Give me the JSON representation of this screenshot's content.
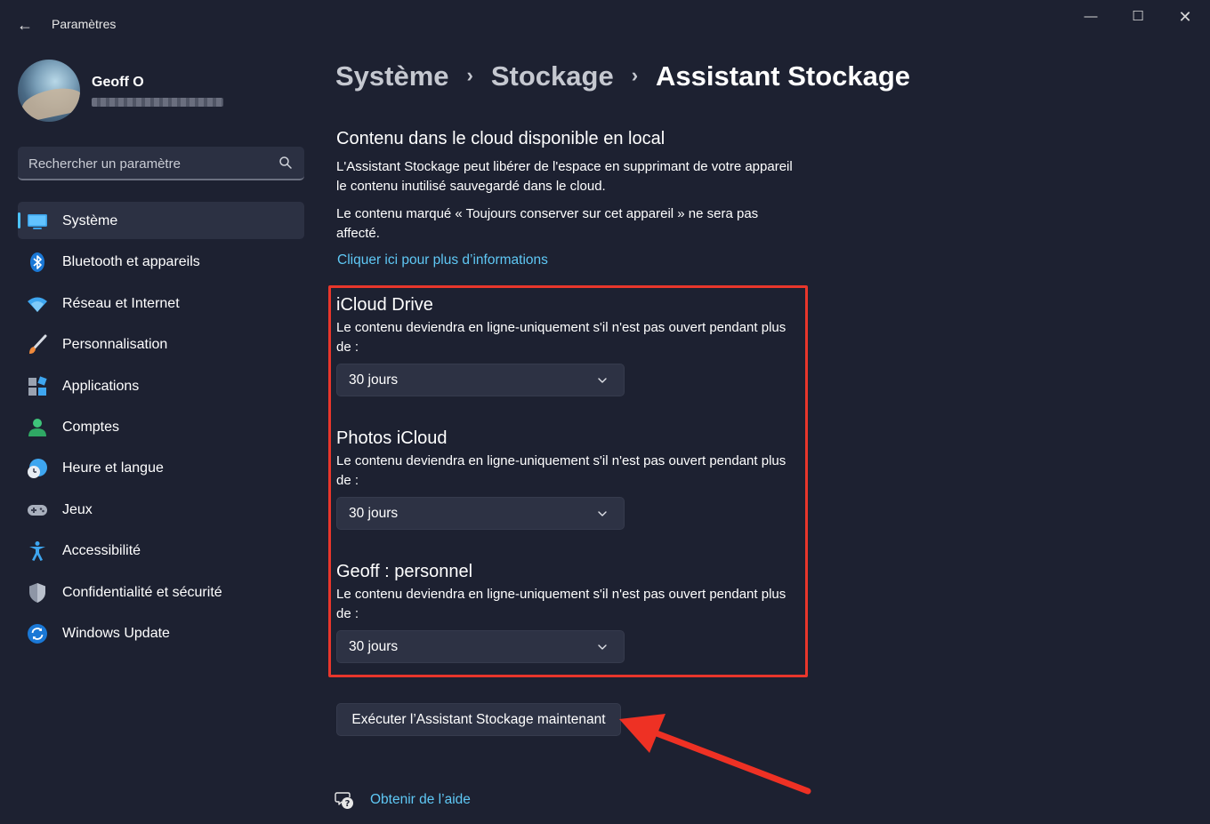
{
  "window": {
    "title": "Paramètres",
    "controls": {
      "minimize": "—",
      "maximize": "☐",
      "close": "✕"
    }
  },
  "user": {
    "name": "Geoff O"
  },
  "search": {
    "placeholder": "Rechercher un paramètre"
  },
  "nav": {
    "items": [
      {
        "label": "Système",
        "icon": "system-icon",
        "active": true
      },
      {
        "label": "Bluetooth et appareils",
        "icon": "bluetooth-icon"
      },
      {
        "label": "Réseau et Internet",
        "icon": "wifi-icon"
      },
      {
        "label": "Personnalisation",
        "icon": "brush-icon"
      },
      {
        "label": "Applications",
        "icon": "apps-icon"
      },
      {
        "label": "Comptes",
        "icon": "account-icon"
      },
      {
        "label": "Heure et langue",
        "icon": "clock-globe-icon"
      },
      {
        "label": "Jeux",
        "icon": "gamepad-icon"
      },
      {
        "label": "Accessibilité",
        "icon": "accessibility-icon"
      },
      {
        "label": "Confidentialité et sécurité",
        "icon": "shield-icon"
      },
      {
        "label": "Windows Update",
        "icon": "update-icon"
      }
    ]
  },
  "breadcrumb": {
    "level1": "Système",
    "level2": "Stockage",
    "current": "Assistant Stockage",
    "separator": "›"
  },
  "main": {
    "section_title": "Contenu dans le cloud disponible en local",
    "para1": "L'Assistant Stockage peut libérer de l'espace en supprimant de votre appareil le contenu inutilisé sauvegardé dans le cloud.",
    "para2": "Le contenu marqué « Toujours conserver sur cet appareil » ne sera pas affecté.",
    "info_link": "Cliquer ici pour plus d’informations",
    "groups": [
      {
        "title": "iCloud Drive",
        "desc": "Le contenu deviendra en ligne-uniquement s'il n'est pas ouvert pendant plus de :",
        "value": "30 jours"
      },
      {
        "title": "Photos iCloud",
        "desc": "Le contenu deviendra en ligne-uniquement s'il n'est pas ouvert pendant plus de :",
        "value": "30 jours"
      },
      {
        "title": "Geoff : personnel",
        "desc": "Le contenu deviendra en ligne-uniquement s'il n'est pas ouvert pendant plus de :",
        "value": "30 jours"
      }
    ],
    "run_button": "Exécuter l’Assistant Stockage maintenant",
    "help_link": "Obtenir de l’aide"
  },
  "colors": {
    "background": "#1d2131",
    "accent": "#4cc2ff",
    "link": "#5fc8f5",
    "annotation": "#e8362b"
  }
}
